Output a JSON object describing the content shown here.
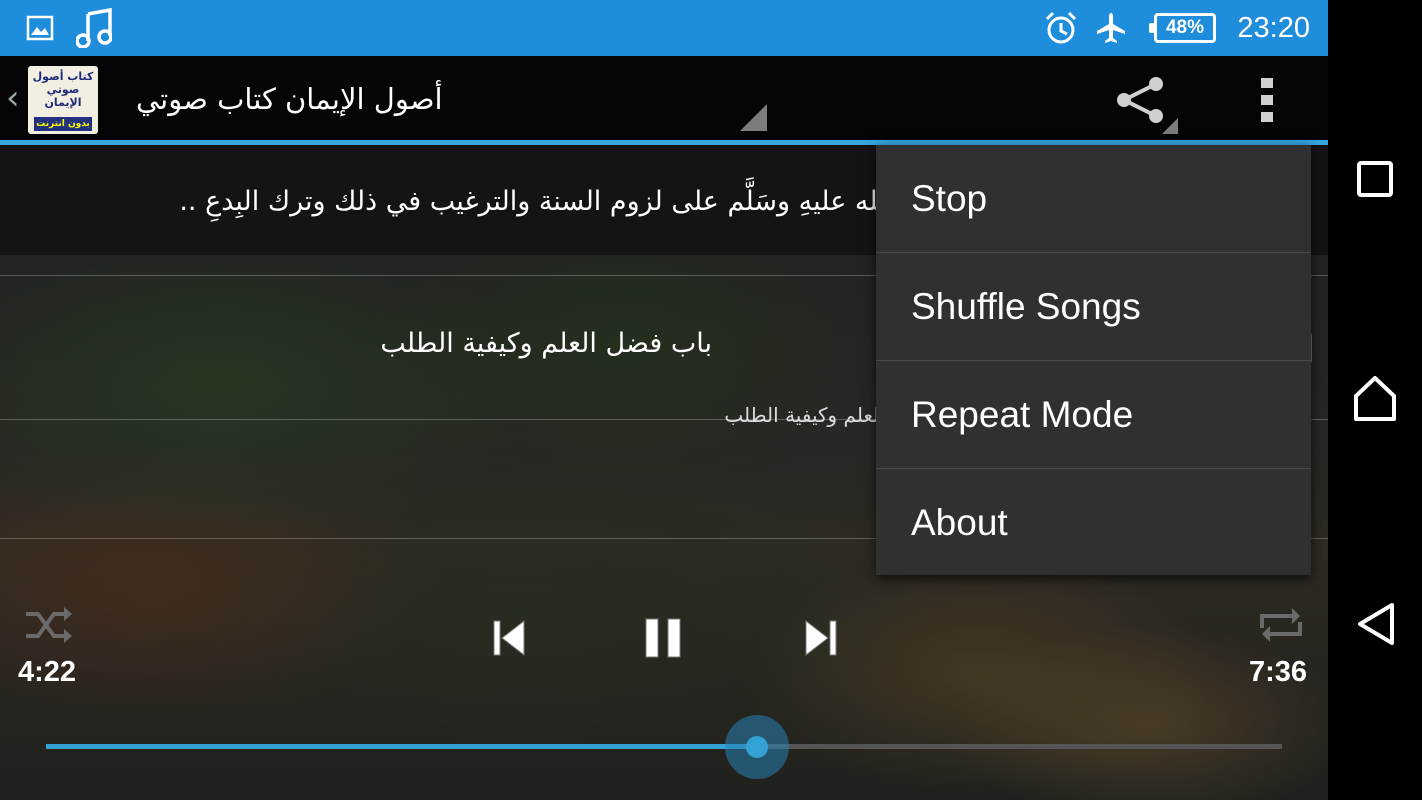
{
  "status_bar": {
    "time": "23:20",
    "battery_percent": "48%",
    "icons": [
      "gallery-icon",
      "music-note-icon",
      "alarm-icon",
      "airplane-icon",
      "battery-icon"
    ],
    "color": "#1e8ddb"
  },
  "action_bar": {
    "title": "أصول الإيمان كتاب صوتي",
    "logo_text": "كتاب أصول صوتي الإيمان",
    "logo_badge": "بدون انترنت",
    "accent": "#36a6dd"
  },
  "tracks": {
    "item1": "…صلى الله عليهِ وسَلَّم على لزوم السنة والترغيب في ذلك وترك البِدعِ ..",
    "item2": "باب فضل العلم وكيفية الطلب",
    "item2_sub": "باب فضل العلم وكيفية الطلب"
  },
  "player": {
    "elapsed": "4:22",
    "duration": "7:36",
    "progress_fraction": 0.575
  },
  "menu": {
    "items": [
      "Stop",
      "Shuffle Songs",
      "Repeat Mode",
      "About"
    ]
  },
  "nav_bar": {
    "icons": [
      "recent-apps-icon",
      "home-icon",
      "back-icon"
    ]
  }
}
